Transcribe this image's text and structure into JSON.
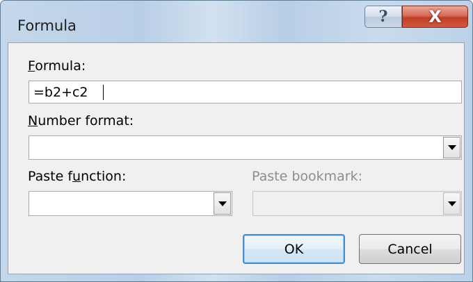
{
  "window": {
    "title": "Formula",
    "help_glyph": "?",
    "close_glyph": "X"
  },
  "formula": {
    "label_prefix": "",
    "label_mnemonic": "F",
    "label_rest": "ormula:",
    "value": "=b2+c2"
  },
  "number_format": {
    "label_prefix": "",
    "label_mnemonic": "N",
    "label_rest": "umber format:",
    "selected": ""
  },
  "paste_function": {
    "label_prefix": "Paste f",
    "label_mnemonic": "u",
    "label_rest": "nction:",
    "selected": ""
  },
  "paste_bookmark": {
    "label": "Paste bookmark:",
    "selected": "",
    "enabled": false
  },
  "buttons": {
    "ok_label": "OK",
    "cancel_label": "Cancel"
  },
  "icons": {
    "help": "help-icon",
    "close": "close-icon",
    "dropdown": "chevron-down-icon"
  },
  "colors": {
    "close_button": "#c94a30",
    "default_button_border": "#3c8fd6",
    "dialog_background": "#f0f0f0"
  }
}
